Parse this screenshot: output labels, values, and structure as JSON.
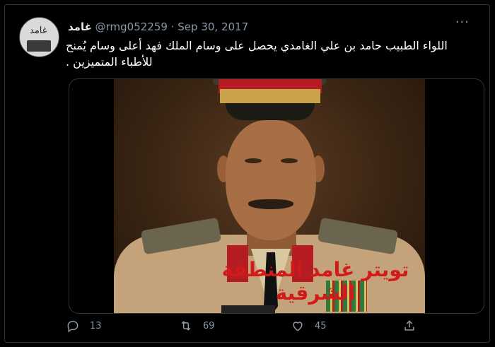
{
  "tweet": {
    "display_name": "غامد",
    "handle": "@rmg052259",
    "separator": "·",
    "date": "Sep 30, 2017",
    "more_label": "···",
    "text": "اللواء الطبيب حامد بن علي الغامدي يحصل على وسام الملك فهد أعلى وسام يُمنح للأطباء المتميزين .",
    "avatar_text": "غامد",
    "media": {
      "watermark": "تويتر غامد المنطقة الشرقية",
      "icon": "photo-of-officer"
    },
    "actions": {
      "reply_count": "13",
      "retweet_count": "69",
      "like_count": "45",
      "share_icon": "share-icon"
    }
  },
  "colors": {
    "background": "#000000",
    "text": "#e7e9ea",
    "muted": "#8b98a5",
    "watermark": "#d11a1a"
  }
}
